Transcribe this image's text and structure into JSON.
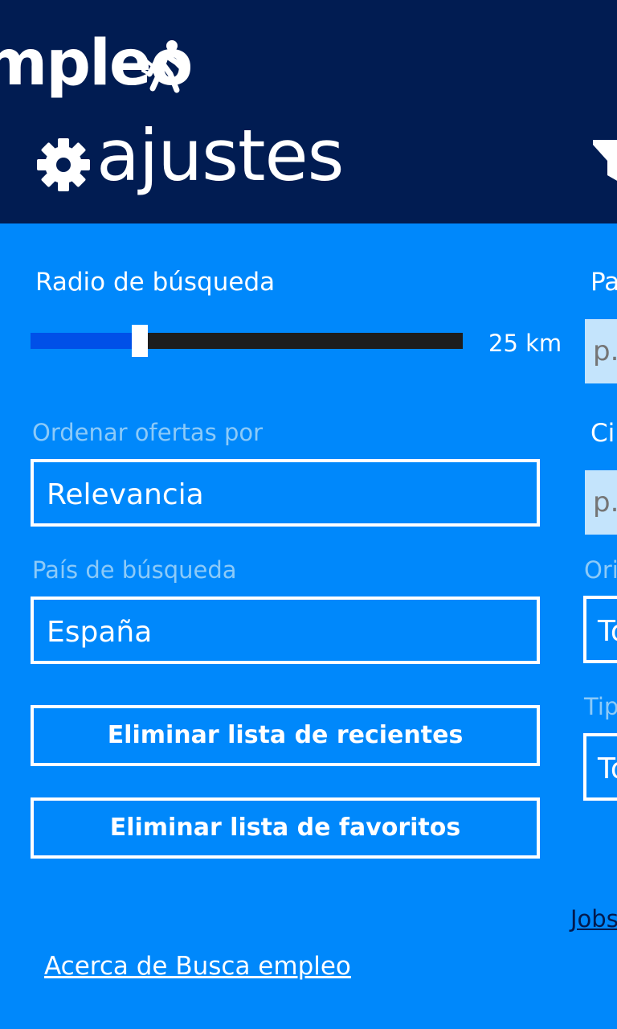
{
  "header": {
    "app_title": "mpleo",
    "page_title": "ajustes",
    "icons": [
      "walker-icon",
      "gear-icon",
      "filter-icon"
    ]
  },
  "settings": {
    "radius_label": "Radio de búsqueda",
    "radius_value_text": "25 km",
    "radius_fraction": 0.25,
    "sort_label": "Ordenar ofertas por",
    "sort_value": "Relevancia",
    "country_label": "País de búsqueda",
    "country_value": "España",
    "clear_recent_label": "Eliminar lista de recientes",
    "clear_favorites_label": "Eliminar lista de favoritos",
    "about_link": "Acerca de Busca empleo"
  },
  "filters": {
    "field1_label": "Pa",
    "field1_placeholder": "p.",
    "field2_label": "Ci",
    "field2_placeholder": "p.",
    "origin_label": "Ori",
    "origin_value": "To",
    "type_label": "Tip",
    "type_value": "To",
    "jobs_link": "Jobs"
  },
  "colors": {
    "header_bg": "#011c52",
    "content_bg": "#0088fb",
    "slider_fill": "#0050e8",
    "slider_track": "#1d1d1d"
  }
}
